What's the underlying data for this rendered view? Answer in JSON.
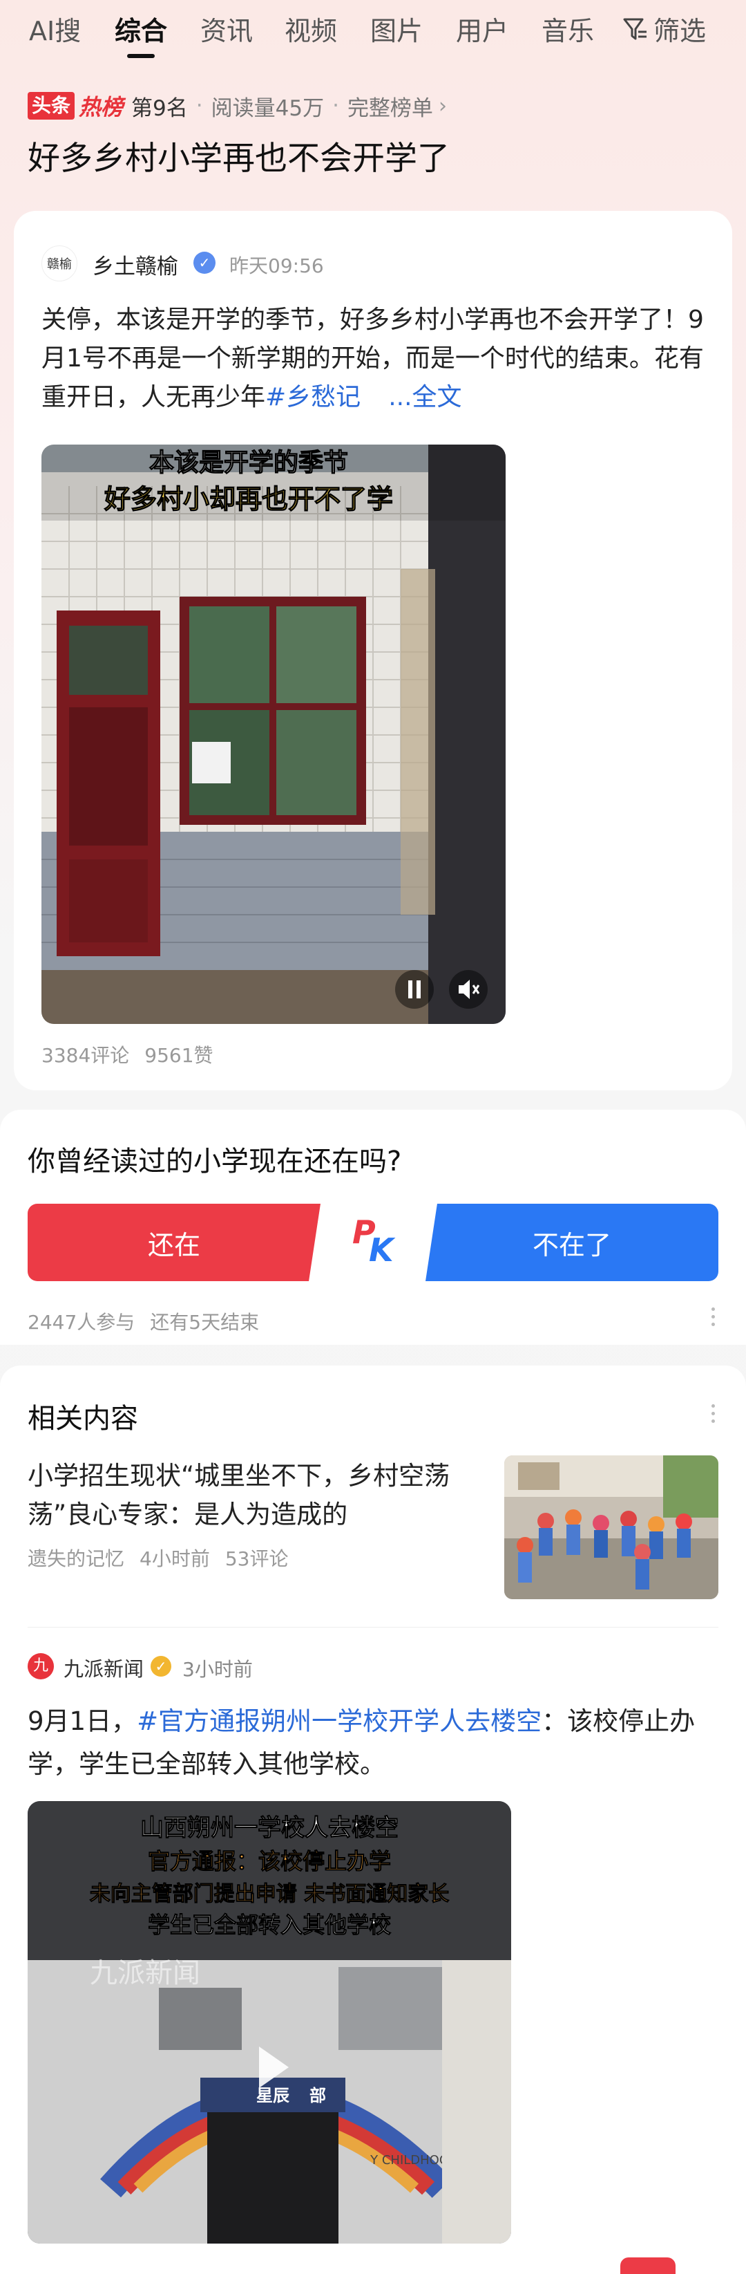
{
  "tabs": [
    {
      "label": "AI搜"
    },
    {
      "label": "综合"
    },
    {
      "label": "资讯"
    },
    {
      "label": "视频"
    },
    {
      "label": "图片"
    },
    {
      "label": "用户"
    },
    {
      "label": "音乐"
    },
    {
      "label": "筛选"
    }
  ],
  "rank": {
    "badge": "头条",
    "hot": "热榜",
    "position": "第9名",
    "reads": "阅读量45万",
    "full_list": "完整榜单",
    "sep": "·"
  },
  "title": "好多乡村小学再也不会开学了",
  "post": {
    "author": "乡土赣榆",
    "time": "昨天09:56",
    "avatar_text": "赣榆",
    "text": "关停，本该是开学的季节，好多乡村小学再也不会开学了！9月1号不再是一个新学期的开始，而是一个时代的结束。花有重开日，人无再少年",
    "tag": "#乡愁记",
    "more": "...全文",
    "video_caption_1": "本该是开学的季节",
    "video_caption_2": "好多村小却再也开不了学",
    "comments": "3384评论",
    "likes": "9561赞"
  },
  "poll": {
    "question": "你曾经读过的小学现在还在吗?",
    "yes": "还在",
    "no": "不在了",
    "pk_p": "P",
    "pk_k": "K",
    "participants": "2447人参与",
    "remaining": "还有5天结束"
  },
  "related": {
    "title": "相关内容",
    "article1": {
      "title": "小学招生现状“城里坐不下，乡村空荡荡”良心专家：是人为造成的",
      "source": "遗失的记忆",
      "time": "4小时前",
      "comments": "53评论"
    },
    "article2": {
      "source": "九派新闻",
      "source_logo": "九",
      "time": "3小时前",
      "text_prefix": "9月1日，",
      "tag": "#官方通报朔州一学校开学人去楼空",
      "text_suffix": "：该校停止办学，学生已全部转入其他学校。",
      "video_title": "山西朔州一学校人去楼空",
      "video_line2": "官方通报：该校停止办学",
      "video_line3": "未向主管部门提出申请 未书面通知家长",
      "video_line4": "学生已全部转入其他学校",
      "watermark": "九派新闻",
      "building_sign": "星辰",
      "building_sign2": "部",
      "wall_text": "Y CHILDHOOD"
    }
  },
  "colors": {
    "red": "#ec3b46",
    "blue": "#2a78f4",
    "link": "#2b6ad8"
  }
}
